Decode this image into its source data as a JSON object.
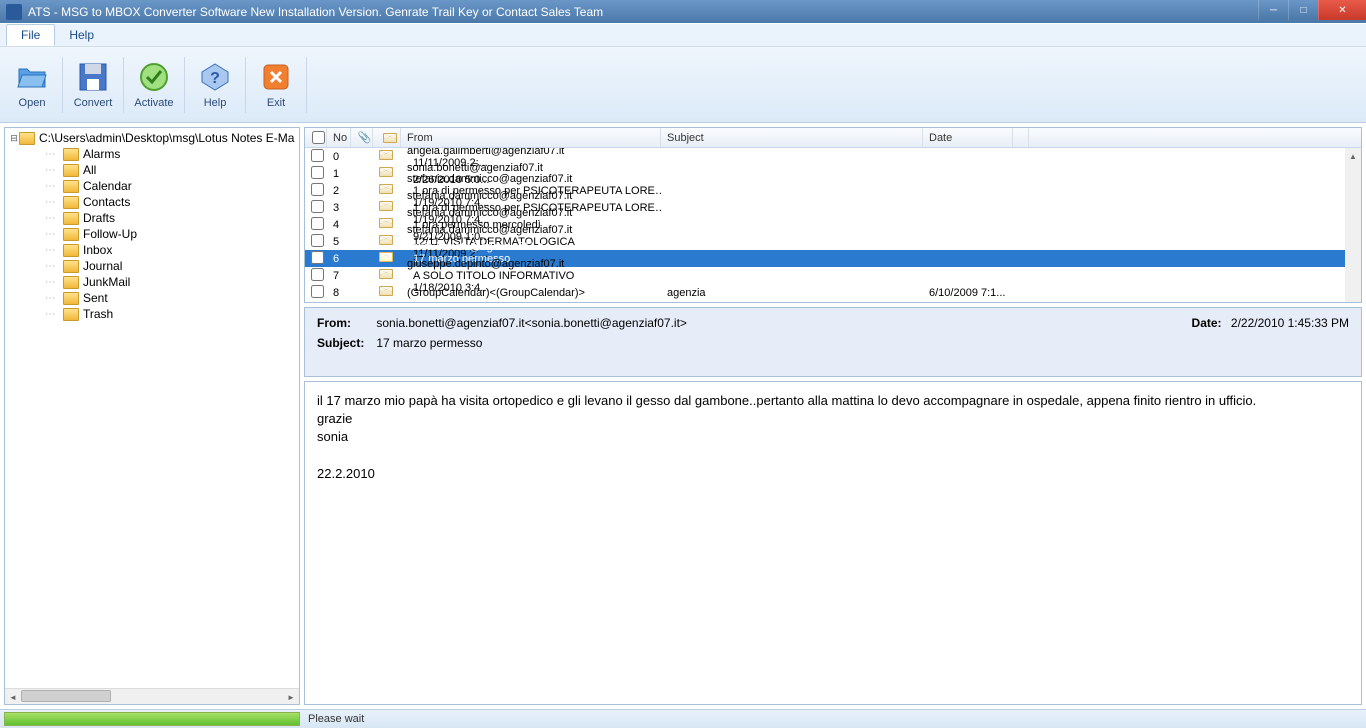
{
  "window": {
    "title": "ATS - MSG to MBOX Converter Software New Installation Version. Genrate Trail Key or Contact Sales Team"
  },
  "menu": {
    "file": "File",
    "help": "Help"
  },
  "toolbar": {
    "open": "Open",
    "convert": "Convert",
    "activate": "Activate",
    "help": "Help",
    "exit": "Exit"
  },
  "tree": {
    "root": "C:\\Users\\admin\\Desktop\\msg\\Lotus Notes E-Ma",
    "items": [
      "Alarms",
      "All",
      "Calendar",
      "Contacts",
      "Drafts",
      "Follow-Up",
      "Inbox",
      "Journal",
      "JunkMail",
      "Sent",
      "Trash"
    ]
  },
  "columns": {
    "no": "No",
    "from": "From",
    "subject": "Subject",
    "date": "Date"
  },
  "messages": [
    {
      "no": "0",
      "from": "angela.galimberti@agenziaf07.it<angela.galimberti...",
      "subject": "",
      "date": "11/11/2009 2:..."
    },
    {
      "no": "1",
      "from": "sonia.bonetti@agenziaf07.it<sonia.bonetti@agenzi...",
      "subject": "",
      "date": "2/26/2010 5:0..."
    },
    {
      "no": "2",
      "from": "stefania.dammicco@agenziaf07.it<stefania.dammic...",
      "subject": "1 ora di permesso per PSICOTERAPEUTA LOREN...",
      "date": "1/19/2010 7:4..."
    },
    {
      "no": "3",
      "from": "stefania.dammicco@agenziaf07.it<stefania.dammic...",
      "subject": "1 ora di permesso per PSICOTERAPEUTA LOREN...",
      "date": "1/19/2010 7:4..."
    },
    {
      "no": "4",
      "from": "stefania.dammicco@agenziaf07.it<stefania.dammic...",
      "subject": "1 ora permesso mercoledì",
      "date": "9/21/2009 1:0..."
    },
    {
      "no": "5",
      "from": "stefania.dammicco@agenziaf07.it<stefania.dammic...",
      "subject": "12/11 VISITA DERMATOLOGICA",
      "date": "11/11/2009 2:..."
    },
    {
      "no": "6",
      "from": "sonia.bonetti@agenziaf07.it<sonia.bonetti@agenzi...",
      "subject": "17 marzo permesso",
      "date": "2/22/2010 1:4..."
    },
    {
      "no": "7",
      "from": "giuseppe.depinto@agenziaf07.it<giuseppe.depinto...",
      "subject": "A SOLO TITOLO INFORMATIVO",
      "date": "1/18/2010 3:4..."
    },
    {
      "no": "8",
      "from": "(GroupCalendar)<(GroupCalendar)>",
      "subject": "agenzia",
      "date": "6/10/2009 7:1..."
    }
  ],
  "selectedIndex": 6,
  "preview": {
    "from_label": "From:",
    "from": "sonia.bonetti@agenziaf07.it<sonia.bonetti@agenziaf07.it>",
    "date_label": "Date:",
    "date": "2/22/2010 1:45:33 PM",
    "subject_label": "Subject:",
    "subject": "17 marzo permesso",
    "body_l1": "il 17 marzo mio papà ha visita ortopedico e gli levano il gesso dal gambone..pertanto alla mattina lo devo accompagnare in ospedale, appena finito rientro in ufficio.",
    "body_l2": "grazie",
    "body_l3": "sonia",
    "body_l4": "22.2.2010"
  },
  "status": {
    "text": "Please wait",
    "progress_pct": 100
  }
}
